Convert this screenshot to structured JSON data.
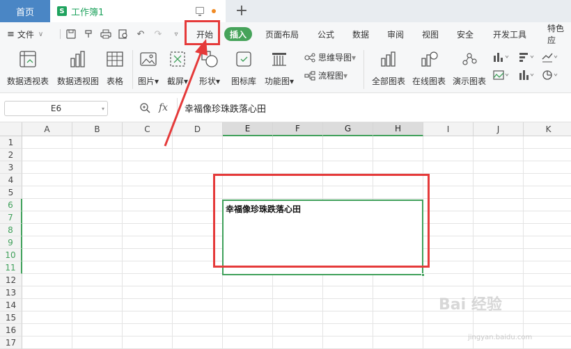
{
  "tabs": {
    "home": "首页",
    "doc_icon": "S",
    "doc_name": "工作簿1",
    "new_tab": "+"
  },
  "menu": {
    "file": "文件",
    "items": [
      "开始",
      "插入",
      "页面布局",
      "公式",
      "数据",
      "审阅",
      "视图",
      "安全",
      "开发工具",
      "特色应"
    ],
    "active_index": 1,
    "accent": "#46a35a"
  },
  "ribbon": {
    "pivot_table": "数据透视表",
    "pivot_chart": "数据透视图",
    "table": "表格",
    "picture": "图片",
    "screenshot": "截屏",
    "shape": "形状",
    "icon_lib": "图标库",
    "func_chart": "功能图",
    "mindmap": "思维导图",
    "flowchart": "流程图",
    "all_charts": "全部图表",
    "online_charts": "在线图表",
    "demo_charts": "演示图表"
  },
  "formula": {
    "cell_ref": "E6",
    "fx": "fx",
    "content": "幸福像珍珠跌落心田"
  },
  "grid": {
    "columns": [
      "A",
      "B",
      "C",
      "D",
      "E",
      "F",
      "G",
      "H",
      "I",
      "J",
      "K"
    ],
    "selected_columns": [
      "E",
      "F",
      "G",
      "H"
    ],
    "rows": [
      "1",
      "2",
      "3",
      "4",
      "5",
      "6",
      "7",
      "8",
      "9",
      "10",
      "11",
      "12",
      "13",
      "14",
      "15",
      "16",
      "17"
    ],
    "selected_rows": [
      "6",
      "7",
      "8",
      "9",
      "10",
      "11"
    ],
    "merged_text": "幸福像珍珠跌落心田"
  },
  "watermark": {
    "main": "Bai 经验",
    "sub": "jingyan.baidu.com"
  },
  "colors": {
    "annotation": "#e53a3a",
    "selection": "#3fa05a",
    "home_tab": "#4a86c5"
  }
}
